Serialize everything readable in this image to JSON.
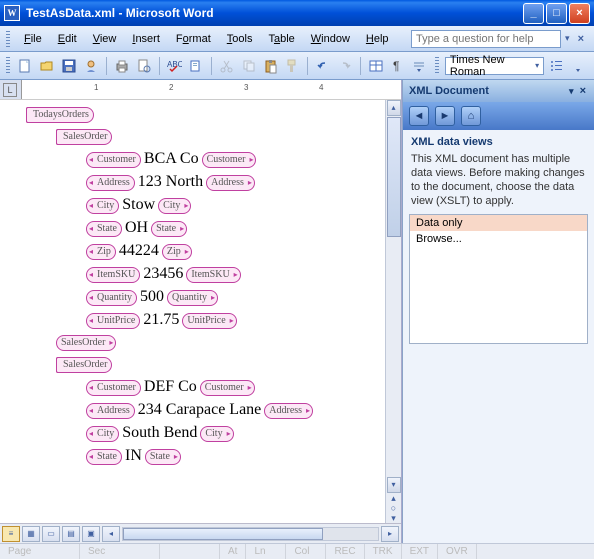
{
  "title": "TestAsData.xml - Microsoft Word",
  "menu": {
    "file": "File",
    "edit": "Edit",
    "view": "View",
    "insert": "Insert",
    "format": "Format",
    "tools": "Tools",
    "table": "Table",
    "window": "Window",
    "help": "Help"
  },
  "help_box": "Type a question for help",
  "font_selector": "Times New Roman",
  "taskpane": {
    "title": "XML Document",
    "section": "XML data views",
    "desc": "This XML document has multiple data views. Before making changes to the document, choose the data view (XSLT) to apply.",
    "items": [
      "Data only",
      "Browse..."
    ]
  },
  "doc": {
    "root": "TodaysOrders",
    "sales1": "SalesOrder",
    "r1": {
      "o": "Customer",
      "v": "BCA Co",
      "c": "Customer"
    },
    "r2": {
      "o": "Address",
      "v": "123 North",
      "c": "Address"
    },
    "r3": {
      "o": "City",
      "v": "Stow",
      "c": "City"
    },
    "r4": {
      "o": "State",
      "v": "OH",
      "c": "State"
    },
    "r5": {
      "o": "Zip",
      "v": "44224",
      "c": "Zip"
    },
    "r6": {
      "o": "ItemSKU",
      "v": "23456",
      "c": "ItemSKU"
    },
    "r7": {
      "o": "Quantity",
      "v": "500",
      "c": "Quantity"
    },
    "r8": {
      "o": "UnitPrice",
      "v": "21.75",
      "c": "UnitPrice"
    },
    "salesclose": "SalesOrder",
    "sales2": "SalesOrder",
    "r9": {
      "o": "Customer",
      "v": "DEF Co",
      "c": "Customer"
    },
    "r10": {
      "o": "Address",
      "v": "234 Carapace Lane",
      "c": "Address"
    },
    "r11": {
      "o": "City",
      "v": "South Bend",
      "c": "City"
    },
    "r12": {
      "o": "State",
      "v": "IN",
      "c": "State"
    }
  },
  "status": {
    "page": "Page",
    "sec": "Sec",
    "at": "At",
    "ln": "Ln",
    "col": "Col",
    "rec": "REC",
    "trk": "TRK",
    "ext": "EXT",
    "ovr": "OVR"
  }
}
